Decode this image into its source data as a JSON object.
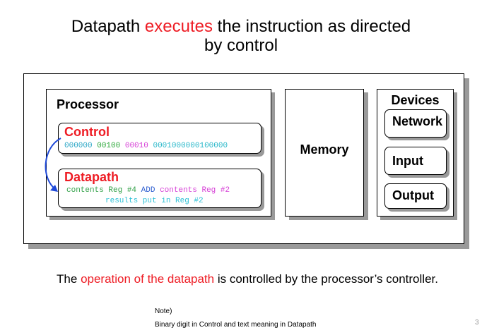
{
  "title": {
    "line1_a": "Datapath ",
    "line1_highlight": "executes",
    "line1_b": " the instruction as directed",
    "line2": "by control"
  },
  "diagram": {
    "processor": "Processor",
    "control": {
      "label": "Control",
      "binary": [
        "000000",
        "00100",
        "00010",
        "0001000000100000"
      ]
    },
    "datapath": {
      "label": "Datapath",
      "line1": [
        "contents Reg #4",
        "ADD",
        "contents Reg #2"
      ],
      "line2": "results put in Reg #2"
    },
    "memory": "Memory",
    "devices": {
      "label": "Devices",
      "items": [
        "Network",
        "Input",
        "Output"
      ]
    }
  },
  "statement": {
    "before": "The ",
    "highlight": "operation of the datapath",
    "after": " is controlled by the processor’s controller."
  },
  "note": {
    "heading": "Note)",
    "text": "Binary digit in Control and text meaning in Datapath"
  },
  "page_number": "3",
  "colors": {
    "accent_red": "#ee1c24",
    "arrow_blue": "#1f49d8"
  }
}
